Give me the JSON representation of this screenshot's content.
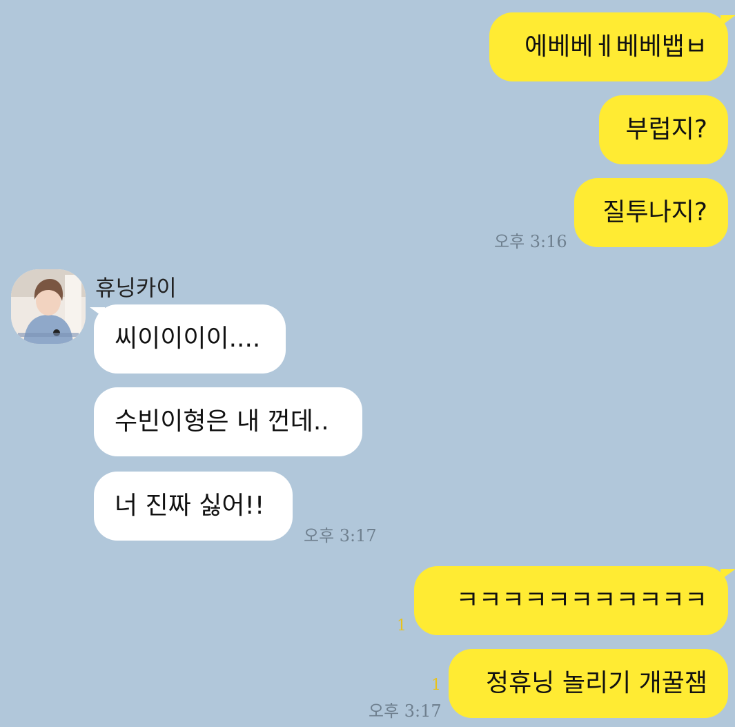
{
  "theme": {
    "background": "#b1c7da",
    "my_bubble_color": "#ffeb33",
    "their_bubble_color": "#ffffff",
    "read_count_color": "#e8c21a"
  },
  "sender": {
    "name": "휴닝카이",
    "avatar_icon": "profile-photo"
  },
  "messages": {
    "m1": "에베베ㅔ베베뱁ㅂ",
    "m2": "부럽지?",
    "m3": "질투나지?",
    "m3_time": "오후 3:16",
    "r1": "씨이이이이....",
    "r2": "수빈이형은 내 껀데..",
    "r3": "너 진짜 싫어!!",
    "r3_time": "오후 3:17",
    "m4": "ㅋㅋㅋㅋㅋㅋㅋㅋㅋㅋㅋ",
    "m4_unread": "1",
    "m5": "정휴닝 놀리기 개꿀잼",
    "m5_unread": "1",
    "m5_time": "오후 3:17"
  }
}
